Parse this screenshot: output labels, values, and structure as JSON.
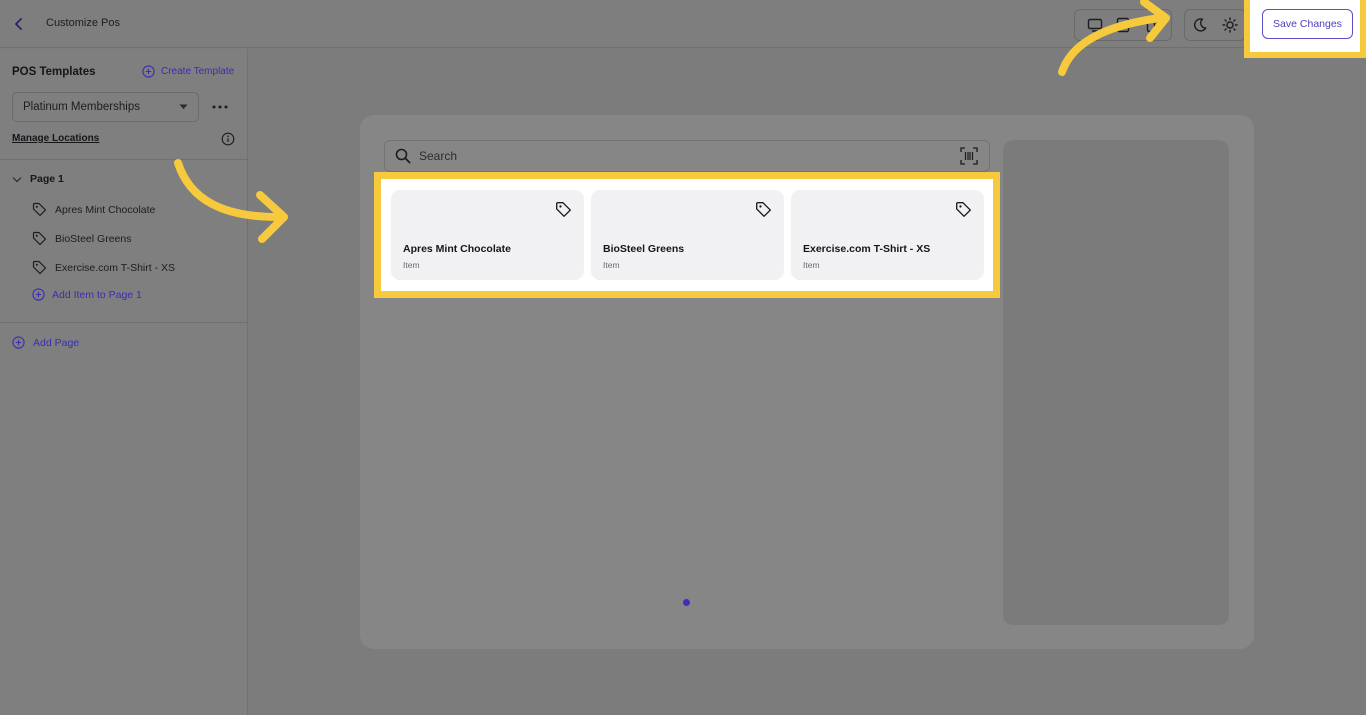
{
  "header": {
    "title": "Customize Pos",
    "save_label": "Save Changes"
  },
  "sidebar": {
    "heading": "POS Templates",
    "create_template_label": "Create Template",
    "selected_template": "Platinum Memberships",
    "manage_locations_label": "Manage Locations",
    "pages": [
      {
        "label": "Page 1",
        "items": [
          {
            "label": "Apres Mint Chocolate"
          },
          {
            "label": "BioSteel Greens"
          },
          {
            "label": "Exercise.com T-Shirt - XS"
          }
        ],
        "add_item_label": "Add Item to Page 1"
      }
    ],
    "add_page_label": "Add Page"
  },
  "preview": {
    "search_placeholder": "Search",
    "cards": [
      {
        "name": "Apres Mint Chocolate",
        "type": "Item"
      },
      {
        "name": "BioSteel Greens",
        "type": "Item"
      },
      {
        "name": "Exercise.com T-Shirt - XS",
        "type": "Item"
      }
    ]
  },
  "colors": {
    "accent": "#4b3fc0",
    "highlight": "#f6ca3c",
    "overlay": "#7e7e7e"
  },
  "icons": [
    "back-chevron-icon",
    "monitor-icon",
    "tablet-icon",
    "phone-icon",
    "moon-icon",
    "sun-icon",
    "plus-circle-icon",
    "caret-down-icon",
    "more-dots-icon",
    "info-icon",
    "chevron-down-icon",
    "tag-icon",
    "search-icon",
    "barcode-icon"
  ]
}
